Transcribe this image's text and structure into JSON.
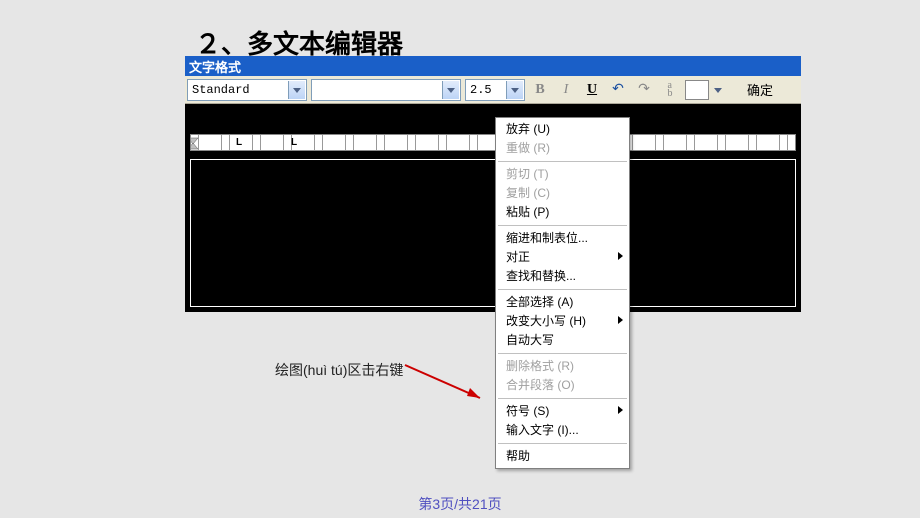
{
  "heading": "２、多文本编辑器",
  "titlebar": "文字格式",
  "toolbar": {
    "style": "Standard",
    "font": "",
    "size": "2.5",
    "bold": "B",
    "italic": "I",
    "underline": "U",
    "undo": "↶",
    "redo": "↷",
    "stack": "a/b",
    "ok": "确定"
  },
  "hint": "绘图(huì tú)区击右键",
  "menu": {
    "undo": {
      "label": "放弃 (U)",
      "enabled": true,
      "sub": false
    },
    "redo": {
      "label": "重做 (R)",
      "enabled": false,
      "sub": false
    },
    "cut": {
      "label": "剪切 (T)",
      "enabled": false,
      "sub": false
    },
    "copy": {
      "label": "复制 (C)",
      "enabled": false,
      "sub": false
    },
    "paste": {
      "label": "粘贴 (P)",
      "enabled": true,
      "sub": false
    },
    "indent": {
      "label": "缩进和制表位...",
      "enabled": true,
      "sub": false
    },
    "justify": {
      "label": "对正",
      "enabled": true,
      "sub": true
    },
    "find": {
      "label": "查找和替换...",
      "enabled": true,
      "sub": false
    },
    "selall": {
      "label": "全部选择 (A)",
      "enabled": true,
      "sub": false
    },
    "case": {
      "label": "改变大小写 (H)",
      "enabled": true,
      "sub": true
    },
    "autocap": {
      "label": "自动大写",
      "enabled": true,
      "sub": false
    },
    "rmfmt": {
      "label": "删除格式 (R)",
      "enabled": false,
      "sub": false
    },
    "merge": {
      "label": "合并段落 (O)",
      "enabled": false,
      "sub": false
    },
    "symbol": {
      "label": "符号 (S)",
      "enabled": true,
      "sub": true
    },
    "input": {
      "label": "输入文字 (I)...",
      "enabled": true,
      "sub": false
    },
    "help": {
      "label": "帮助",
      "enabled": true,
      "sub": false
    }
  },
  "footer": "第3页/共21页"
}
